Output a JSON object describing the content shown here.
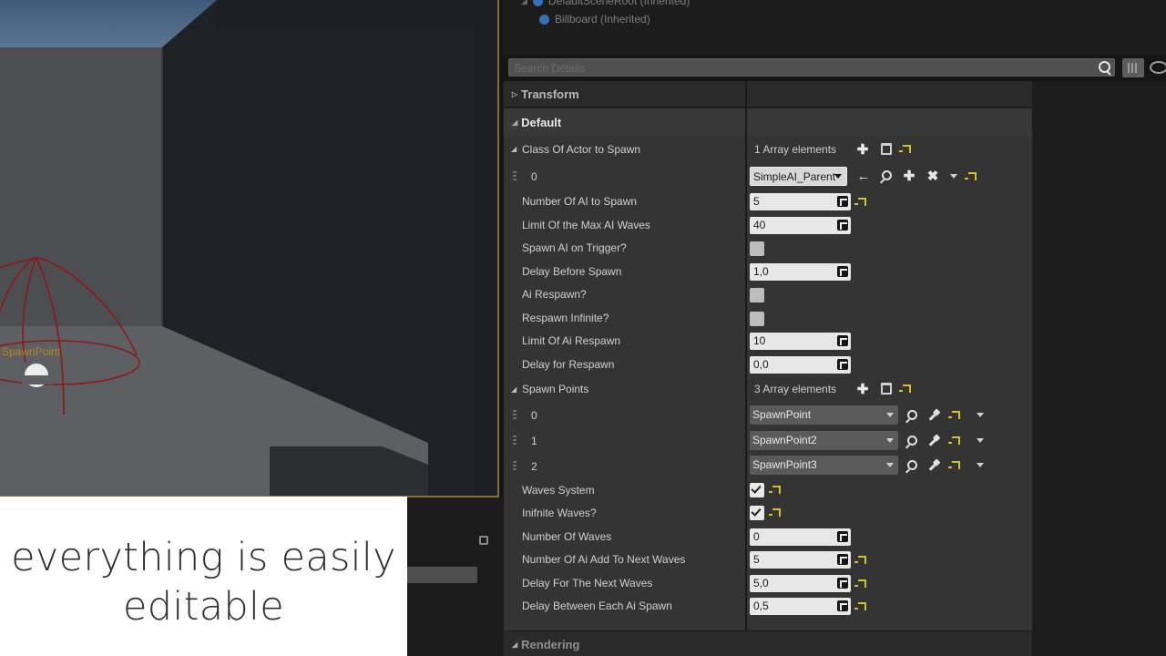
{
  "outliner": {
    "items": [
      {
        "label": "DefaultSceneRoot (Inherited)"
      },
      {
        "label": "Billboard (Inherited)"
      }
    ]
  },
  "details": {
    "search_placeholder": "Search Details",
    "sections": {
      "transform": "Transform",
      "default": "Default",
      "rendering": "Rendering"
    },
    "class_of_actor": {
      "label": "Class Of Actor to Spawn",
      "count": "1 Array elements",
      "element_index": "0",
      "element_value": "SimpleAI_Parent"
    },
    "number_of_ai": {
      "label": "Number Of AI to Spawn",
      "value": "5"
    },
    "limit_max_waves": {
      "label": "Limit Of the Max AI Waves",
      "value": "40"
    },
    "spawn_on_trigger": {
      "label": "Spawn AI on Trigger?",
      "checked": false
    },
    "delay_before_spawn": {
      "label": "Delay Before Spawn",
      "value": "1,0"
    },
    "ai_respawn": {
      "label": "Ai Respawn?",
      "checked": false
    },
    "respawn_infinite": {
      "label": "Respawn Infinite?",
      "checked": false
    },
    "limit_respawn": {
      "label": "Limit Of Ai Respawn",
      "value": "10"
    },
    "delay_respawn": {
      "label": "Delay for Respawn",
      "value": "0,0"
    },
    "spawn_points": {
      "label": "Spawn Points",
      "count": "3 Array elements",
      "items": [
        {
          "index": "0",
          "value": "SpawnPoint"
        },
        {
          "index": "1",
          "value": "SpawnPoint2"
        },
        {
          "index": "2",
          "value": "SpawnPoint3"
        }
      ]
    },
    "waves_system": {
      "label": "Waves System",
      "checked": true
    },
    "infinite_waves": {
      "label": "Inifnite Waves?",
      "checked": true
    },
    "number_of_waves": {
      "label": "Number Of Waves",
      "value": "0"
    },
    "add_to_next": {
      "label": "Number Of Ai Add To Next Waves",
      "value": "5"
    },
    "delay_next_waves": {
      "label": "Delay For The Next Waves",
      "value": "5,0"
    },
    "delay_each_spawn": {
      "label": "Delay Between Each Ai Spawn",
      "value": "0,5"
    }
  },
  "viewport": {
    "spawn_label": "SpawnPoint"
  },
  "caption": {
    "line1": "everything is easily",
    "line2": "editable"
  },
  "colors": {
    "accent_reset": "#d4c12c",
    "viewport_frame": "#8a6d2a",
    "spawn_label": "#c58a14",
    "gizmo": "#8b1a1a"
  }
}
